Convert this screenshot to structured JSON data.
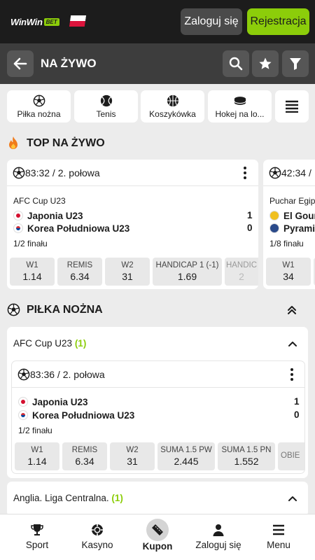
{
  "header": {
    "logo_text": "WinWin",
    "logo_badge": "BET",
    "login_label": "Zaloguj się",
    "register_label": "Rejestracja",
    "accent_color": "#8ccd0a"
  },
  "subheader": {
    "title": "NA ŻYWO",
    "icons": [
      "back-arrow-icon",
      "search-icon",
      "star-icon",
      "filter-icon"
    ]
  },
  "sport_tabs": [
    {
      "label": "Piłka nożna",
      "icon": "soccer-ball-icon"
    },
    {
      "label": "Tenis",
      "icon": "tennis-ball-icon"
    },
    {
      "label": "Koszykówka",
      "icon": "basketball-icon"
    },
    {
      "label": "Hokej na lo...",
      "icon": "hockey-puck-icon"
    }
  ],
  "top_live": {
    "title": "TOP NA ŻYWO",
    "cards": [
      {
        "time": "83:32",
        "period": "2. połowa",
        "league": "AFC Cup U23",
        "teams": [
          {
            "name": "Japonia U23",
            "score": "1"
          },
          {
            "name": "Korea Południowa U23",
            "score": "0"
          }
        ],
        "stage": "1/2 finału",
        "odds": [
          {
            "label": "W1",
            "value": "1.14"
          },
          {
            "label": "REMIS",
            "value": "6.34"
          },
          {
            "label": "W2",
            "value": "31"
          },
          {
            "label": "HANDICAP 1 (-1)",
            "value": "1.69"
          },
          {
            "label": "HANDIC",
            "value": "2"
          }
        ]
      },
      {
        "time": "42:34",
        "period": "/",
        "league": "Puchar Egip",
        "teams": [
          {
            "name": "El Gour",
            "score": ""
          },
          {
            "name": "Pyrami",
            "score": ""
          }
        ],
        "stage": "1/8 finału",
        "odds": [
          {
            "label": "W1",
            "value": "34"
          }
        ]
      }
    ]
  },
  "soccer_section": {
    "title": "PIŁKA NOŻNA",
    "leagues": [
      {
        "name": "AFC Cup U23",
        "count": "(1)",
        "match": {
          "time": "83:36",
          "period": "2. połowa",
          "teams": [
            {
              "name": "Japonia U23",
              "score": "1"
            },
            {
              "name": "Korea Południowa U23",
              "score": "0"
            }
          ],
          "stage": "1/2 finału",
          "odds": [
            {
              "label": "W1",
              "value": "1.14"
            },
            {
              "label": "REMIS",
              "value": "6.34"
            },
            {
              "label": "W2",
              "value": "31"
            },
            {
              "label": "SUMA 1.5 PW",
              "value": "2.445"
            },
            {
              "label": "SUMA 1.5 PN",
              "value": "1.552"
            },
            {
              "label": "OBIE",
              "value": ""
            }
          ]
        }
      },
      {
        "name": "Anglia. Liga Centralna.",
        "count": "(1)"
      }
    ]
  },
  "bottom_nav": [
    {
      "label": "Sport",
      "icon": "trophy-icon"
    },
    {
      "label": "Kasyno",
      "icon": "casino-chip-icon"
    },
    {
      "label": "Kupon",
      "icon": "ticket-icon"
    },
    {
      "label": "Zaloguj się",
      "icon": "user-icon"
    },
    {
      "label": "Menu",
      "icon": "hamburger-menu-icon"
    }
  ]
}
